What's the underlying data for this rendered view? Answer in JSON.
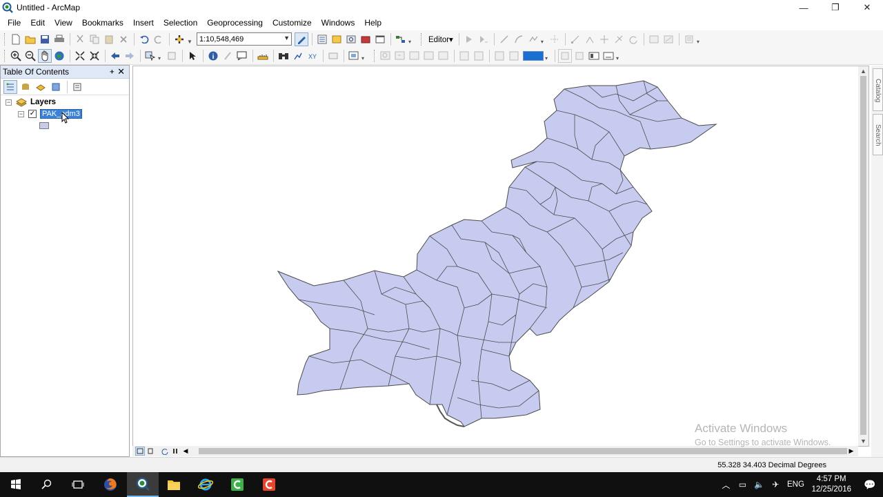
{
  "window": {
    "title": "Untitled - ArcMap",
    "minimize": "—",
    "maximize": "❐",
    "close": "✕"
  },
  "menu": [
    "File",
    "Edit",
    "View",
    "Bookmarks",
    "Insert",
    "Selection",
    "Geoprocessing",
    "Customize",
    "Windows",
    "Help"
  ],
  "toolbar": {
    "scale": "1:10,548,469",
    "editor_label": "Editor▾"
  },
  "toc": {
    "title": "Table Of Contents",
    "pin": "ᚐ",
    "close": "✕",
    "group_label": "Layers",
    "layer_name": "PAK_adm3",
    "layer_checked": true,
    "layer_fill_color": "#c8cbf0"
  },
  "map": {
    "fill_color": "#c8cbf0",
    "stroke_color": "#4a4a4a"
  },
  "watermark": {
    "line1": "Activate Windows",
    "line2": "Go to Settings to activate Windows."
  },
  "status": {
    "coordinates": "55.328  34.403 Decimal Degrees"
  },
  "taskbar": {
    "language": "ENG",
    "time": "4:57 PM",
    "date": "12/25/2016"
  },
  "dock": {
    "tab1": "Catalog",
    "tab2": "Search"
  }
}
